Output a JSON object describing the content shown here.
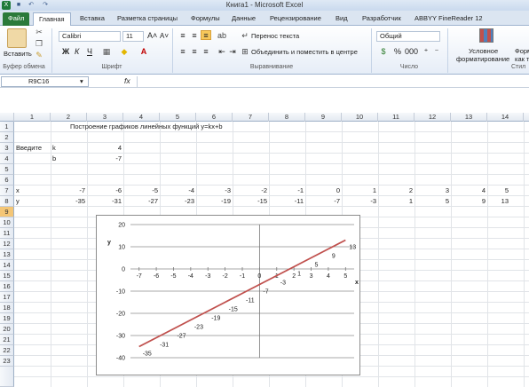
{
  "window": {
    "title": "Книга1 - Microsoft Excel"
  },
  "tabs": [
    "Файл",
    "Главная",
    "Вставка",
    "Разметка страницы",
    "Формулы",
    "Данные",
    "Рецензирование",
    "Вид",
    "Разработчик",
    "ABBYY FineReader 12"
  ],
  "ribbon": {
    "paste_label": "Вставить",
    "clipboard_label": "Буфер обмена",
    "font_name": "Calibri",
    "font_size": "11",
    "font_group_label": "Шрифт",
    "bold": "Ж",
    "italic": "К",
    "underline": "Ч",
    "wrap_text": "Перенос текста",
    "merge_center": "Объединить и поместить в центре",
    "alignment_label": "Выравнивание",
    "number_format": "Общий",
    "number_label": "Число",
    "cond_format_line1": "Условное",
    "cond_format_line2": "форматирование",
    "format_table_line1": "Форм",
    "format_table_line2": "как т",
    "styles_label": "Стил"
  },
  "formula_bar": {
    "name_box": "R9C16",
    "fx": "fx",
    "value": ""
  },
  "columns": [
    "1",
    "2",
    "3",
    "4",
    "5",
    "6",
    "7",
    "8",
    "9",
    "10",
    "11",
    "12",
    "13",
    "14"
  ],
  "rows": [
    "1",
    "2",
    "3",
    "4",
    "5",
    "6",
    "7",
    "8",
    "9",
    "10",
    "11",
    "12",
    "13",
    "14",
    "15",
    "16",
    "17",
    "18",
    "19",
    "20",
    "21",
    "22",
    "23"
  ],
  "selected_row": "9",
  "sheet": {
    "heading": "Построение графиков линейных функций y=kx+b",
    "input_label": "Введите",
    "k_label": "k",
    "k_value": "4",
    "b_label": "b",
    "b_value": "-7",
    "x_label": "x",
    "y_label": "y",
    "x_values": [
      "-7",
      "-6",
      "-5",
      "-4",
      "-3",
      "-2",
      "-1",
      "0",
      "1",
      "2",
      "3",
      "4",
      "5"
    ],
    "y_values": [
      "-35",
      "-31",
      "-27",
      "-23",
      "-19",
      "-15",
      "-11",
      "-7",
      "-3",
      "1",
      "5",
      "9",
      "13"
    ]
  },
  "chart_data": {
    "type": "line",
    "x": [
      -7,
      -6,
      -5,
      -4,
      -3,
      -2,
      -1,
      0,
      1,
      2,
      3,
      4,
      5
    ],
    "series": [
      {
        "values": [
          -35,
          -31,
          -27,
          -23,
          -19,
          -15,
          -11,
          -7,
          -3,
          1,
          5,
          9,
          13
        ]
      }
    ],
    "ylabel": "y",
    "xlabel": "x",
    "ylim": [
      -40,
      20
    ],
    "xlim": [
      -7.5,
      5.5
    ],
    "yticks": [
      20,
      10,
      0,
      -10,
      -20,
      -30,
      -40
    ],
    "xticks": [
      -7,
      -6,
      -5,
      -4,
      -3,
      -2,
      -1,
      0,
      1,
      2,
      3,
      4,
      5
    ],
    "data_labels": [
      "-35",
      "-31",
      "-27",
      "-23",
      "-19",
      "-15",
      "-11",
      "-7",
      "-3",
      "1",
      "5",
      "9",
      "13"
    ],
    "grid": true,
    "line_color": "#c0504d"
  }
}
